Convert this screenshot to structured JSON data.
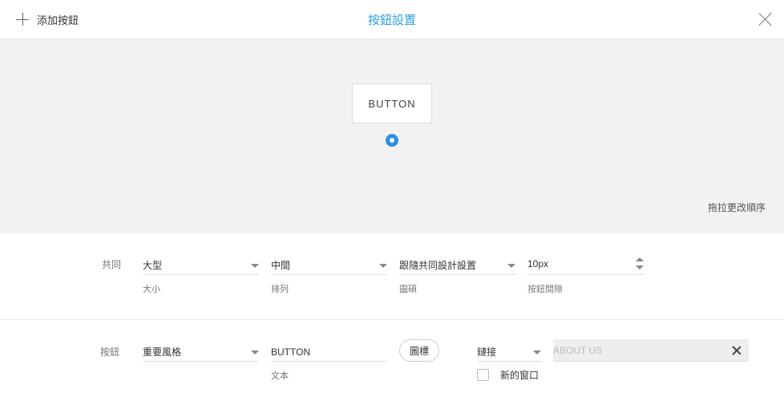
{
  "header": {
    "add_button_label": "添加按鈕",
    "title": "按鈕設置"
  },
  "preview": {
    "button_text": "BUTTON",
    "drag_hint": "拖拉更改順序"
  },
  "common_row": {
    "label": "共同",
    "size": {
      "value": "大型",
      "label": "大小"
    },
    "alignment": {
      "value": "中間",
      "label": "排列"
    },
    "icon_color": {
      "value": "跟隨共同設計設置",
      "label": "圖碩"
    },
    "spacing": {
      "value": "10px",
      "label": "按鈕間隙"
    }
  },
  "button_row": {
    "label": "按鈕",
    "style": {
      "value": "重要風格"
    },
    "text": {
      "value": "BUTTON",
      "label": "文本"
    },
    "icon_button_label": "圖標",
    "link_type": {
      "value": "鏈接"
    },
    "link_url": {
      "placeholder": "ABOUT US"
    },
    "new_window": {
      "label": "新的窗口",
      "checked": false
    }
  },
  "colors": {
    "accent": "#2aa0e0",
    "drag_handle": "#2b8fe0",
    "preview_bg": "#f2f2f2"
  },
  "icons": {
    "add": "plus-icon",
    "close": "close-icon",
    "dropdown": "chevron-down-icon",
    "clear": "clear-icon"
  }
}
